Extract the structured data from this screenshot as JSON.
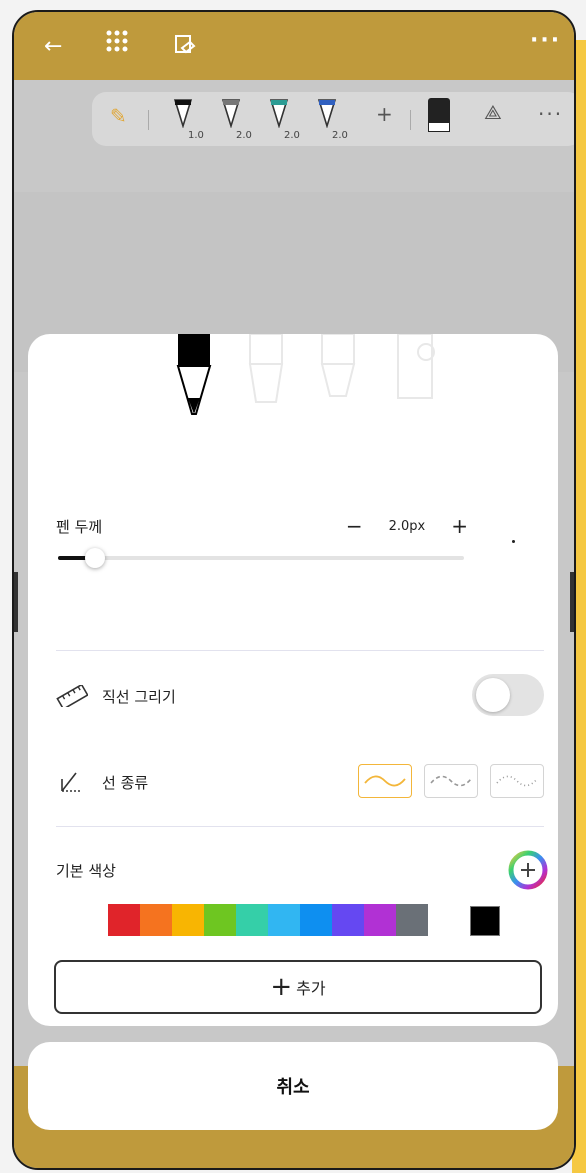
{
  "topbar": {
    "icons": [
      "back-arrow-icon",
      "grid-dots-icon",
      "pages-icon",
      "more-icon"
    ],
    "back": "←",
    "more": "···"
  },
  "toolbar": {
    "pens": [
      {
        "width": "1.0",
        "color": "#111111"
      },
      {
        "width": "2.0",
        "color": "#777777"
      },
      {
        "width": "2.0",
        "color": "#2c9c94"
      },
      {
        "width": "2.0",
        "color": "#3060c0"
      }
    ],
    "add": "+",
    "more": "···"
  },
  "pen_panel": {
    "thickness": {
      "label": "펜 두께",
      "minus": "−",
      "value": "2.0px",
      "plus": "+",
      "slider_fraction": 0.09
    },
    "straight_line": {
      "label": "직선 그리기",
      "enabled": false
    },
    "line_type": {
      "label": "선 종류",
      "options": [
        "solid",
        "dashed",
        "dotted"
      ],
      "selected": "solid"
    },
    "colors": {
      "label": "기본 색상",
      "swatches": [
        "#e0242a",
        "#f5731f",
        "#f8b502",
        "#6ec621",
        "#35cfa8",
        "#31b6f2",
        "#0e8ff0",
        "#6548f2",
        "#b131d4",
        "#6a7077"
      ],
      "current": "#000000"
    },
    "add_label": "추가",
    "add_icon": "+"
  },
  "cancel_label": "취소"
}
